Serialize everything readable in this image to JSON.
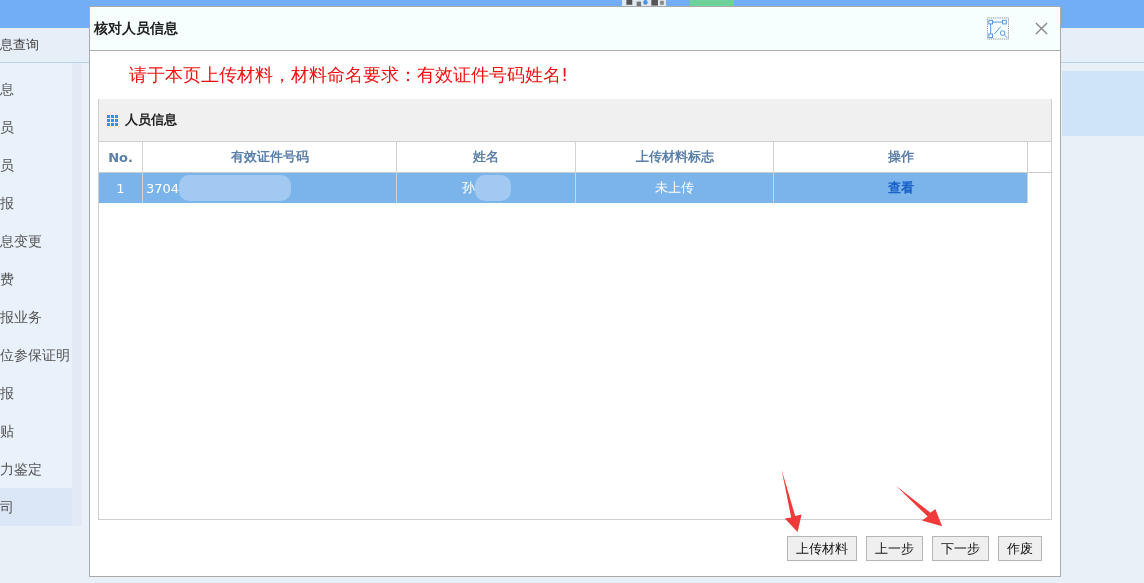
{
  "background": {
    "breadcrumb": "息查询",
    "sidebar": [
      {
        "label": "息",
        "selected": false
      },
      {
        "label": "员",
        "selected": false
      },
      {
        "label": "员",
        "selected": false
      },
      {
        "label": "报",
        "selected": false
      },
      {
        "label": "息变更",
        "selected": false
      },
      {
        "label": "费",
        "selected": false
      },
      {
        "label": "报业务",
        "selected": false
      },
      {
        "label": "位参保证明",
        "selected": false
      },
      {
        "label": "报",
        "selected": false
      },
      {
        "label": "贴",
        "selected": false
      },
      {
        "label": "力鉴定",
        "selected": false
      },
      {
        "label": "司",
        "selected": true
      }
    ]
  },
  "dialog": {
    "title": "核对人员信息",
    "notice": "请于本页上传材料，材料命名要求：有效证件号码姓名!",
    "panel": {
      "title": "人员信息",
      "table": {
        "columns": [
          "No.",
          "有效证件号码",
          "姓名",
          "上传材料标志",
          "操作"
        ],
        "rows": [
          {
            "no": "1",
            "id_number": "3704",
            "name": "孙",
            "upload_flag": "未上传",
            "action": "查看",
            "selected": true
          }
        ]
      }
    },
    "buttons": [
      "上传材料",
      "上一步",
      "下一步",
      "作废"
    ]
  }
}
